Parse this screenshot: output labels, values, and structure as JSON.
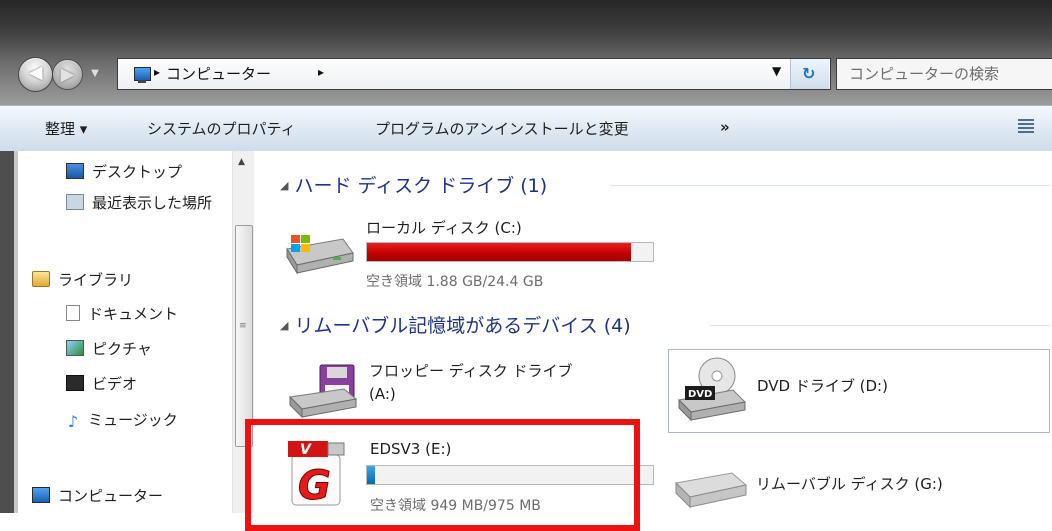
{
  "address": {
    "path": "コンピューター",
    "search_placeholder": "コンピューターの検索"
  },
  "toolbar": {
    "organize": "整理 ▾",
    "system_properties": "システムのプロパティ",
    "uninstall": "プログラムのアンインストールと変更",
    "more": "»"
  },
  "nav": {
    "desktop": "デスクトップ",
    "recent": "最近表示した場所",
    "libraries": "ライブラリ",
    "documents": "ドキュメント",
    "pictures": "ピクチャ",
    "videos": "ビデオ",
    "music": "ミュージック",
    "computer": "コンピューター"
  },
  "groups": {
    "hdd": "ハード ディスク ドライブ (1)",
    "removable": "リムーバブル記憶域があるデバイス (4)"
  },
  "drives": {
    "c": {
      "name": "ローカル ディスク (C:)",
      "free": "空き領域 1.88 GB/24.4 GB",
      "used_fraction": 0.923
    },
    "a": {
      "name_line1": "フロッピー ディスク ドライブ",
      "name_line2": "(A:)"
    },
    "d": {
      "name": "DVD ドライブ (D:)"
    },
    "e": {
      "name": "EDSV3 (E:)",
      "free": "空き領域 949 MB/975 MB",
      "used_fraction": 0.027
    },
    "g": {
      "name": "リムーバブル ディスク (G:)"
    }
  },
  "colors": {
    "hdd_bar_full": "#d40000",
    "bar_normal": "#1a83c9",
    "highlight_box": "#ee1111"
  }
}
